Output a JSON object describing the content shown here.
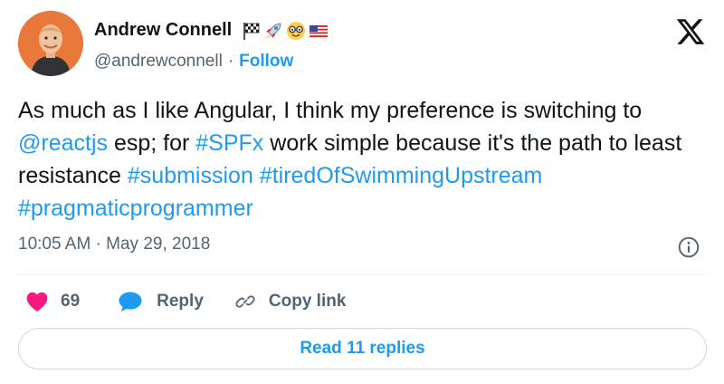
{
  "author": {
    "display_name": "Andrew Connell",
    "handle": "@andrewconnell",
    "separator": "·",
    "follow_label": "Follow",
    "name_emojis": [
      "checkered-flag-icon",
      "rocket-icon",
      "nerd-face-icon",
      "us-flag-icon"
    ]
  },
  "tweet": {
    "segments": [
      {
        "text": "As much as I like Angular, I think my preference is switching to ",
        "link": false
      },
      {
        "text": "@reactjs",
        "link": true
      },
      {
        "text": " esp; for ",
        "link": false
      },
      {
        "text": "#SPFx",
        "link": true
      },
      {
        "text": " work simple because it's the path to least resistance ",
        "link": false
      },
      {
        "text": "#submission",
        "link": true
      },
      {
        "text": " ",
        "link": false
      },
      {
        "text": "#tiredOfSwimmingUpstream",
        "link": true
      },
      {
        "text": " ",
        "link": false
      },
      {
        "text": "#pragmaticprogrammer",
        "link": true
      }
    ],
    "timestamp": "10:05 AM · May 29, 2018"
  },
  "actions": {
    "like_count": "69",
    "reply_label": "Reply",
    "copy_link_label": "Copy link"
  },
  "replies_button_label": "Read 11 replies",
  "colors": {
    "accent": "#1d9bf0",
    "like": "#f91880",
    "text": "#0f1419",
    "muted": "#536471",
    "border": "#cfd9de"
  },
  "icons": {
    "brand": "x-logo-icon",
    "info": "info-icon",
    "like": "heart-icon",
    "reply": "speech-bubble-icon",
    "copy_link": "link-icon"
  }
}
